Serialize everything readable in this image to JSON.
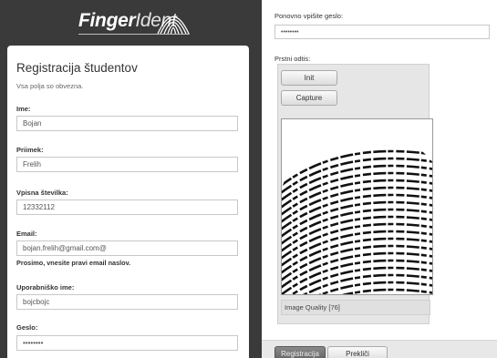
{
  "brand": {
    "name_bold": "Finger",
    "name_light": "Ident"
  },
  "form": {
    "title": "Registracija študentov",
    "note": "Vsa polja so obvezna.",
    "fields": [
      {
        "label": "Ime:",
        "value": "Bojan"
      },
      {
        "label": "Priimek:",
        "value": "Frelih"
      },
      {
        "label": "Vpisna številka:",
        "value": "12332112"
      },
      {
        "label": "Email:",
        "value": "bojan.frelih@gmail.com@",
        "hint": "Prosimo, vnesite pravi email naslov."
      },
      {
        "label": "Uporabniško ime:",
        "value": "bojcbojc"
      },
      {
        "label": "Geslo:",
        "value": "••••••••"
      }
    ]
  },
  "right": {
    "repeat_password_label": "Ponovno vpišite geslo:",
    "repeat_password_value": "••••••••",
    "fingerprint_label": "Prstni odtis:",
    "init_button": "Init",
    "capture_button": "Capture",
    "image_quality": "Image Quality [76]",
    "register_button": "Registracija",
    "cancel_button": "Prekliči"
  }
}
